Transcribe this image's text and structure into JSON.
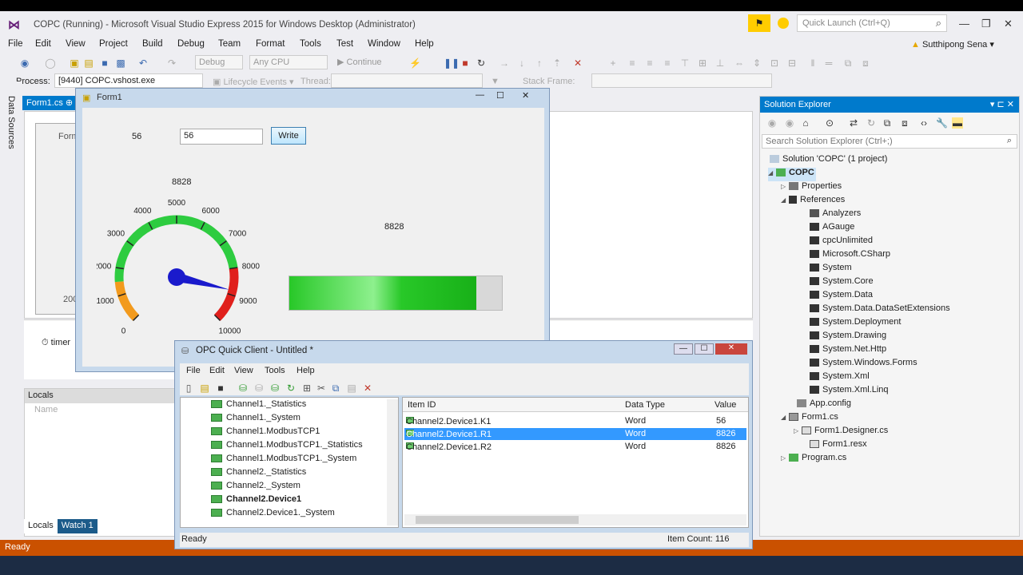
{
  "window": {
    "title": "COPC (Running) - Microsoft Visual Studio Express 2015 for Windows Desktop (Administrator)",
    "quick_launch_placeholder": "Quick Launch (Ctrl+Q)",
    "user": "Sutthipong Sena"
  },
  "menu": [
    "File",
    "Edit",
    "View",
    "Project",
    "Build",
    "Debug",
    "Team",
    "Format",
    "Tools",
    "Test",
    "Window",
    "Help"
  ],
  "toolbar": {
    "config": "Debug",
    "platform": "Any CPU",
    "continue": "Continue",
    "process_label": "Process:",
    "process_value": "[9440] COPC.vshost.exe",
    "lifecycle": "Lifecycle Events",
    "thread": "Thread:",
    "stack_frame": "Stack Frame:"
  },
  "side_tab": "Data Sources",
  "doc_tab": "Form1.cs",
  "designer": {
    "form_tab": "Form",
    "tray_item": "timer",
    "partial_value": "200"
  },
  "form1": {
    "title": "Form1",
    "label_value": "56",
    "input_value": "56",
    "write_button": "Write",
    "gauge_value_label": "8828",
    "bar_value_label": "8828",
    "gauge_ticks": [
      "0",
      "1000",
      "2000",
      "3000",
      "4000",
      "5000",
      "6000",
      "7000",
      "8000",
      "9000",
      "10000"
    ],
    "gauge_value": 8828,
    "gauge_max": 10000,
    "bar_fraction": 0.88
  },
  "locals": {
    "title": "Locals",
    "column": "Name",
    "tabs": [
      "Locals",
      "Watch 1"
    ]
  },
  "status": "Ready",
  "solution_explorer": {
    "title": "Solution Explorer",
    "search_placeholder": "Search Solution Explorer (Ctrl+;)",
    "items": [
      "Solution 'COPC' (1 project)",
      "COPC",
      "Properties",
      "References",
      "Analyzers",
      "AGauge",
      "cpcUnlimited",
      "Microsoft.CSharp",
      "System",
      "System.Core",
      "System.Data",
      "System.Data.DataSetExtensions",
      "System.Deployment",
      "System.Drawing",
      "System.Net.Http",
      "System.Windows.Forms",
      "System.Xml",
      "System.Xml.Linq",
      "App.config",
      "Form1.cs",
      "Form1.Designer.cs",
      "Form1.resx",
      "Program.cs"
    ]
  },
  "opc": {
    "title": "OPC Quick Client - Untitled *",
    "menu": [
      "File",
      "Edit",
      "View",
      "Tools",
      "Help"
    ],
    "tree": [
      "Channel1._Statistics",
      "Channel1._System",
      "Channel1.ModbusTCP1",
      "Channel1.ModbusTCP1._Statistics",
      "Channel1.ModbusTCP1._System",
      "Channel2._Statistics",
      "Channel2._System",
      "Channel2.Device1",
      "Channel2.Device1._System"
    ],
    "columns": [
      "Item ID",
      "Data Type",
      "Value"
    ],
    "rows": [
      {
        "id": "Channel2.Device1.K1",
        "type": "Word",
        "value": "56"
      },
      {
        "id": "Channel2.Device1.R1",
        "type": "Word",
        "value": "8826"
      },
      {
        "id": "Channel2.Device1.R2",
        "type": "Word",
        "value": "8826"
      }
    ],
    "status_left": "Ready",
    "status_right": "Item Count: 116"
  },
  "colors": {
    "vs_accent": "#007acc",
    "status_bar": "#ca5100",
    "gauge_green": "#2ecc40",
    "gauge_red": "#e0201c",
    "gauge_orange": "#f29a1d",
    "needle": "#1a1acc"
  }
}
